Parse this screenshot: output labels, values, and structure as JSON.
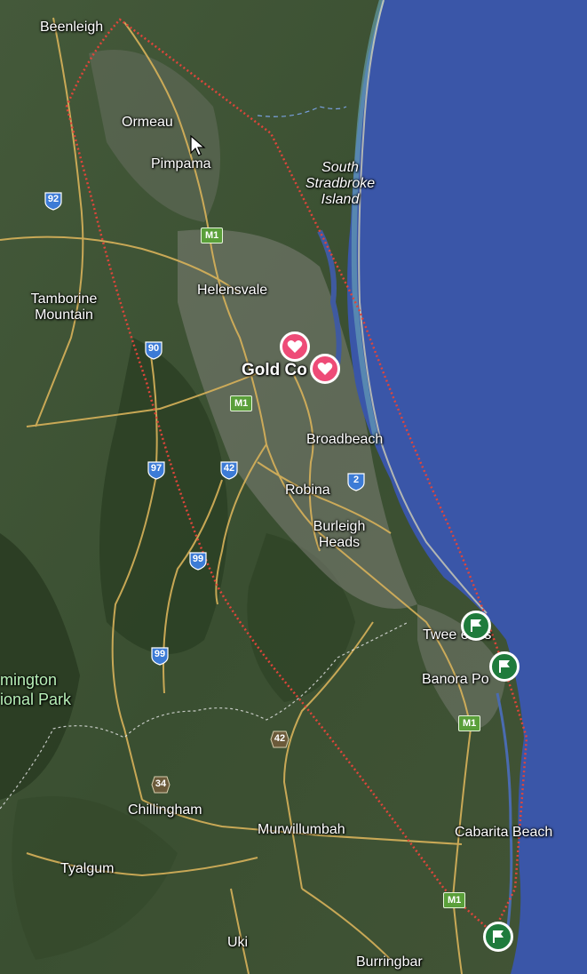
{
  "map": {
    "colors": {
      "ocean": "#3a56a8",
      "land": "#3f5434",
      "road": "#d8b25a",
      "route": "#e0453a",
      "favorite_pin": "#ee4b77",
      "flag_pin": "#1f7b3c"
    },
    "place_labels": {
      "beenleigh": "Beenleigh",
      "ormeau": "Ormeau",
      "pimpama": "Pimpama",
      "south_stradbroke": "South Stradbroke Island",
      "tamborine_mountain": "Tamborine Mountain",
      "helensvale": "Helensvale",
      "gold_coast": "Gold Co",
      "broadbeach": "Broadbeach",
      "robina": "Robina",
      "burleigh_heads": "Burleigh Heads",
      "tweed_heads": "Twee   eads",
      "banora_point": "Banora Po",
      "lamington": "mington",
      "national_park": "ional Park",
      "chillingham": "Chillingham",
      "murwillumbah": "Murwillumbah",
      "cabarita_beach": "Cabarita Beach",
      "tyalgum": "Tyalgum",
      "uki": "Uki",
      "burringbar": "Burringbar"
    },
    "road_shields": {
      "r92": "92",
      "r90": "90",
      "r97": "97",
      "r42a": "42",
      "r2": "2",
      "r99a": "99",
      "r99b": "99",
      "m1_a": "M1",
      "m1_b": "M1",
      "m1_c": "M1",
      "m1_d": "M1",
      "r42b": "42",
      "r34": "34"
    },
    "icons": {
      "favorite": "heart-icon",
      "flag": "flag-icon",
      "cursor": "mouse-pointer-icon"
    }
  }
}
